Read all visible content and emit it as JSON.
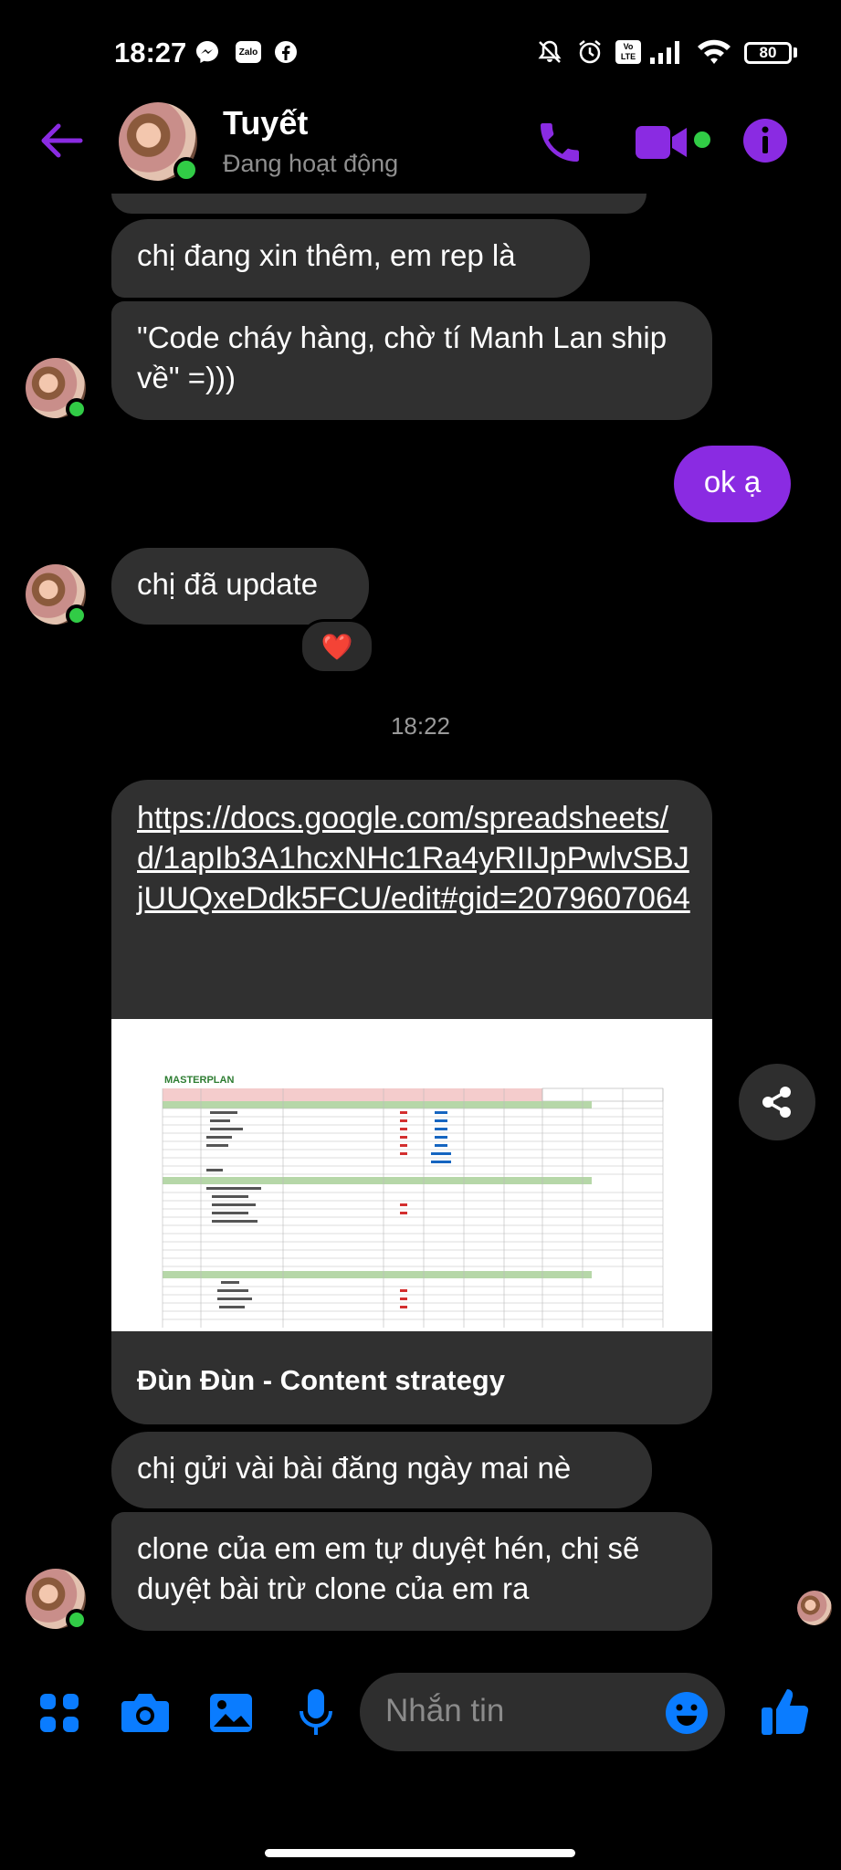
{
  "status_bar": {
    "time": "18:27",
    "battery": "80",
    "icons": [
      "messenger-icon",
      "zalo-icon",
      "facebook-icon",
      "mute-icon",
      "alarm-icon",
      "volte-icon",
      "signal-icon",
      "wifi-icon",
      "battery-icon"
    ],
    "zalo_label": "Zalo",
    "volte_label": "Vo LTE"
  },
  "header": {
    "contact_name": "Tuyết",
    "contact_status": "Đang hoạt động",
    "accent_color": "#8a2be2",
    "online_color": "#31cc46"
  },
  "messages": [
    {
      "direction": "incoming",
      "text": "chị đang xin thêm, em rep là"
    },
    {
      "direction": "incoming",
      "text": "\"Code cháy hàng, chờ tí Manh Lan ship về\" =)))"
    },
    {
      "direction": "outgoing",
      "text": "ok ạ"
    },
    {
      "direction": "incoming",
      "text": "chị đã update",
      "reaction": "❤️"
    },
    {
      "direction": "incoming",
      "text": "chị gửi vài bài đăng ngày mai nè"
    },
    {
      "direction": "incoming",
      "text": "clone của em em tự duyệt hén, chị sẽ duyệt bài trừ clone của em ra"
    }
  ],
  "timestamp": "18:22",
  "link_card": {
    "url": "https://docs.google.com/spreadsheets/d/1apIb3A1hcxNHc1Ra4yRIIJpPwlvSBJjUUQxeDdk5FCU/edit#gid=2079607064",
    "preview_heading": "MASTERPLAN",
    "title": "Đùn Đùn - Content strategy"
  },
  "composer": {
    "placeholder": "Nhắn tin",
    "icons": [
      "apps-icon",
      "camera-icon",
      "gallery-icon",
      "microphone-icon",
      "emoji-icon",
      "like-icon"
    ]
  }
}
